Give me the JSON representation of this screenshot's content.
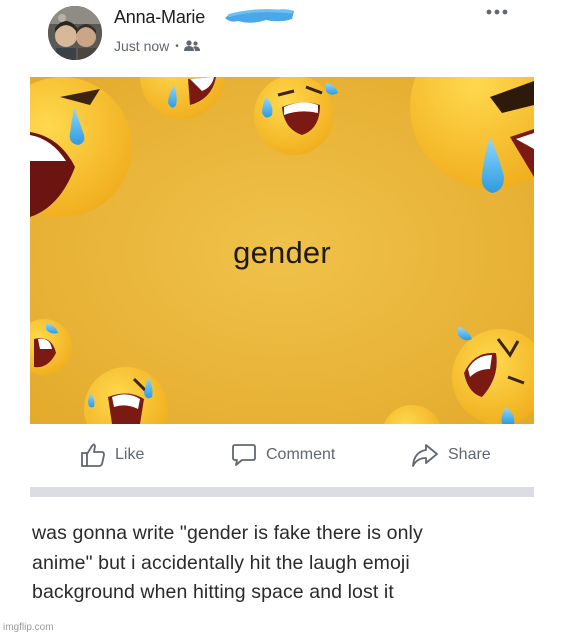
{
  "post": {
    "author": "Anna-Marie",
    "timestamp": "Just now",
    "separator": "•",
    "audience_icon": "friends-icon",
    "more_icon": "more-options-icon",
    "image_text": "gender",
    "image_background": "#ecb83a"
  },
  "actions": {
    "like_label": "Like",
    "comment_label": "Comment",
    "share_label": "Share"
  },
  "caption": {
    "line1": "was gonna write \"gender is fake there is only",
    "line2": "anime\" but i accidentally hit the laugh emoji",
    "line3": "background when hitting space and lost it"
  },
  "watermark": "imgflip.com",
  "colors": {
    "scribble": "#4aa8e8",
    "meta_text": "#606770",
    "divider": "#dadde1"
  }
}
